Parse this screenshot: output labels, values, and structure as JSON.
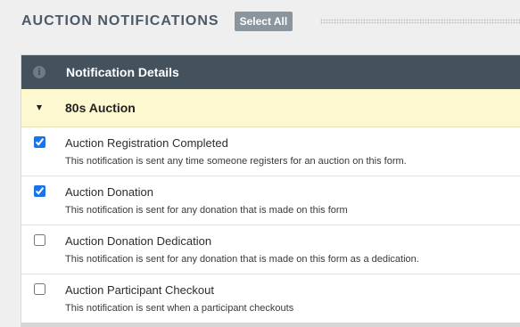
{
  "header": {
    "title": "AUCTION NOTIFICATIONS",
    "select_all_label": "Select All"
  },
  "panel": {
    "header_icon": "info-icon",
    "header_title": "Notification Details",
    "group": {
      "title": "80s Auction",
      "expanded": true
    },
    "items": [
      {
        "title": "Auction Registration Completed",
        "description": "This notification is sent any time someone registers for an auction on this form.",
        "checked": true
      },
      {
        "title": "Auction Donation",
        "description": "This notification is sent for any donation that is made on this form",
        "checked": true
      },
      {
        "title": "Auction Donation Dedication",
        "description": "This notification is sent for any donation that is made on this form as a dedication.",
        "checked": false
      },
      {
        "title": "Auction Participant Checkout",
        "description": "This notification is sent when a participant checkouts",
        "checked": false
      }
    ]
  },
  "colors": {
    "panel_header_bg": "#44525e",
    "group_row_bg": "#fdf8d0",
    "select_all_bg": "#8a959e",
    "title_text": "#4a5a68",
    "checkbox_accent": "#1a73e8"
  }
}
